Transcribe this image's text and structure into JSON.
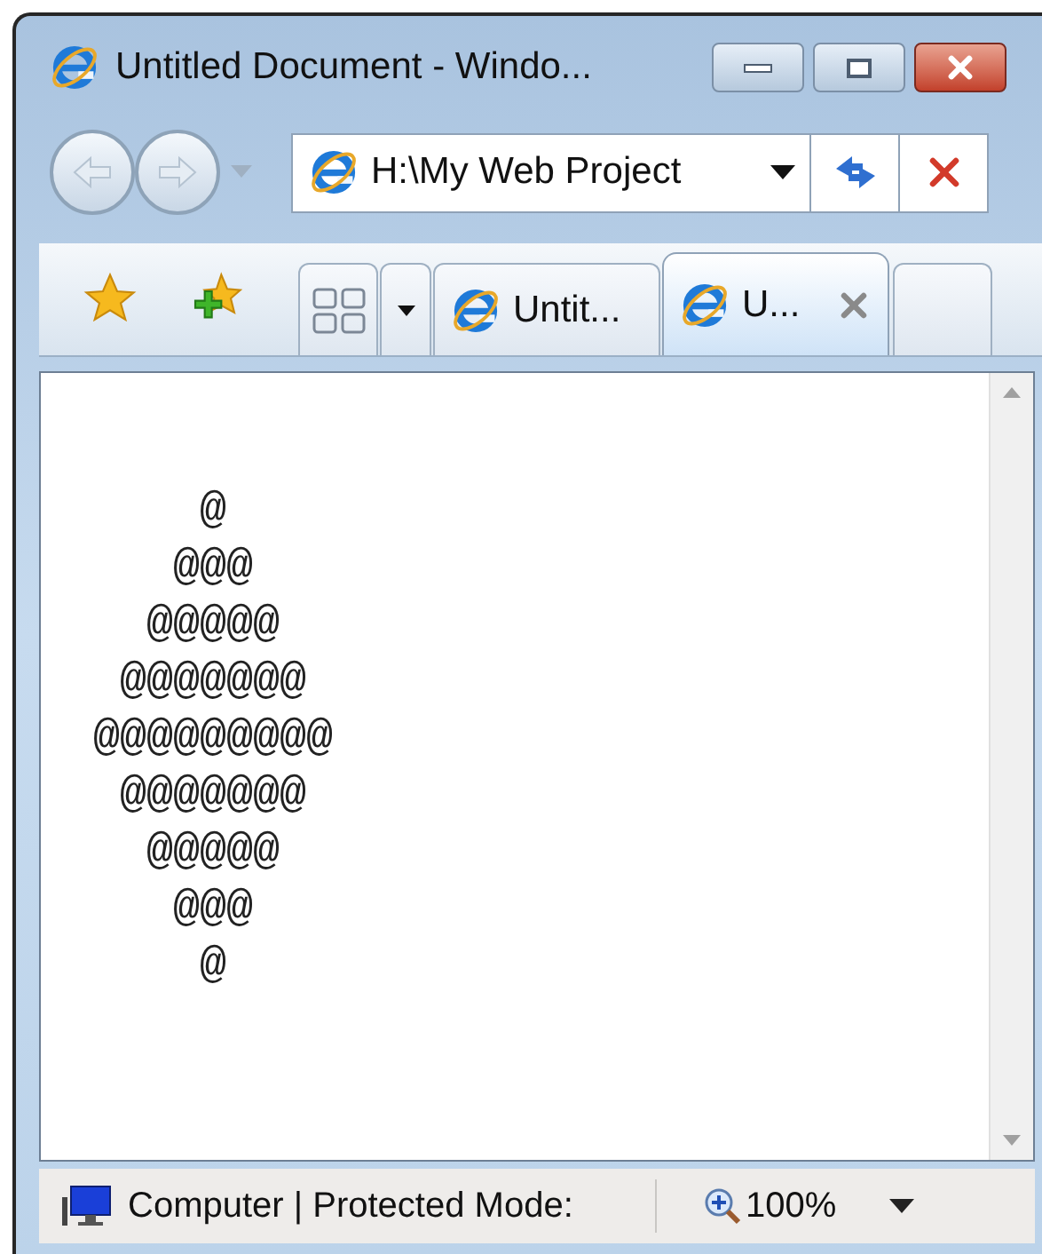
{
  "window": {
    "title": "Untitled Document - Windo..."
  },
  "address_bar": {
    "value": "H:\\My Web Project"
  },
  "tabs": [
    {
      "label": "Untit...",
      "selected": false
    },
    {
      "label": "U...",
      "selected": true
    }
  ],
  "page": {
    "lines": [
      "@",
      "@@@",
      "@@@@@",
      "@@@@@@@",
      "@@@@@@@@@",
      "@@@@@@@",
      "@@@@@",
      "@@@",
      "@"
    ]
  },
  "status_bar": {
    "zone": "Computer | Protected Mode:",
    "zoom": "100%"
  }
}
